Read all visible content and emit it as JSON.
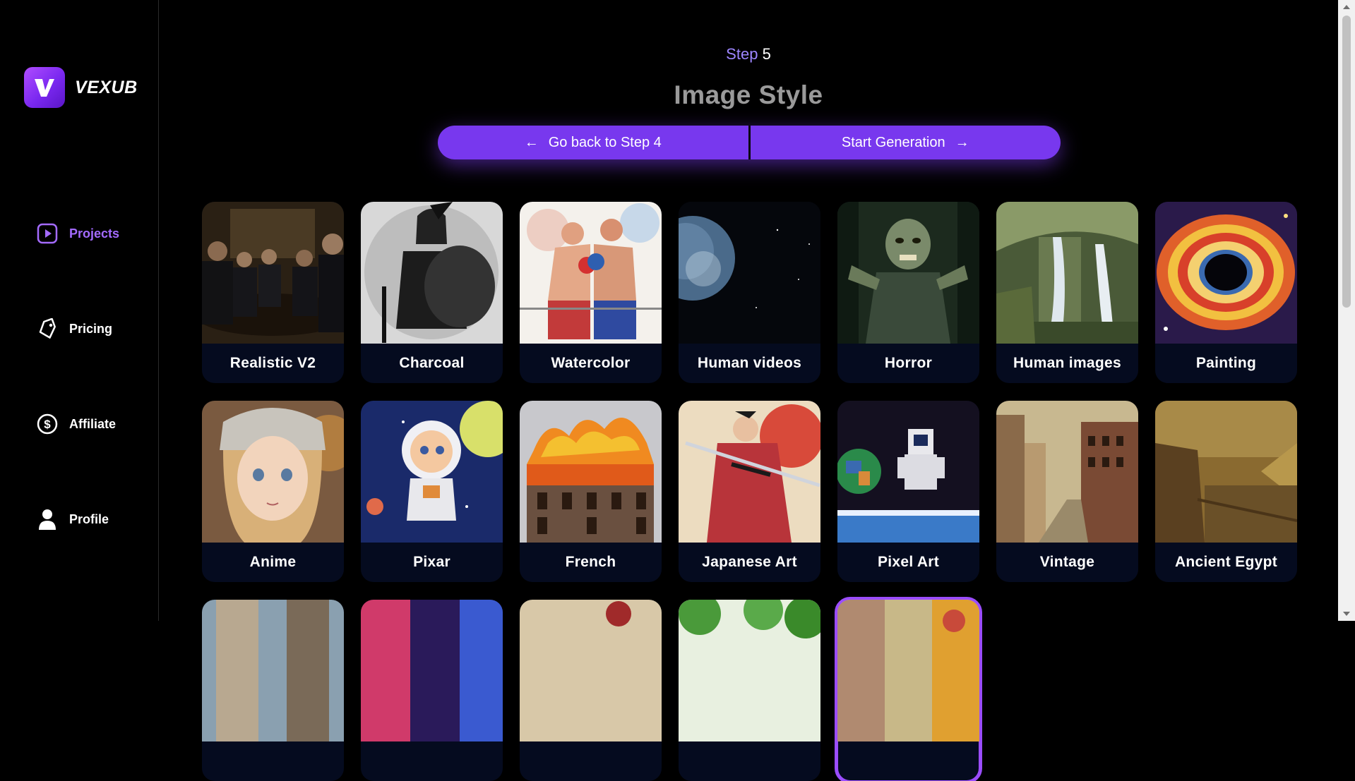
{
  "brand": {
    "name": "VEXUB"
  },
  "sidebar": {
    "items": [
      {
        "label": "Projects",
        "icon": "play-square-icon",
        "active": true
      },
      {
        "label": "Pricing",
        "icon": "tag-icon",
        "active": false
      },
      {
        "label": "Affiliate",
        "icon": "dollar-circle-icon",
        "active": false
      },
      {
        "label": "Profile",
        "icon": "user-icon",
        "active": false
      }
    ]
  },
  "header": {
    "step_word": "Step",
    "step_number": "5",
    "title": "Image Style"
  },
  "actions": {
    "back_label": "Go back to Step 4",
    "start_label": "Start Generation"
  },
  "styles": [
    {
      "label": "Realistic V2"
    },
    {
      "label": "Charcoal"
    },
    {
      "label": "Watercolor"
    },
    {
      "label": "Human videos"
    },
    {
      "label": "Horror"
    },
    {
      "label": "Human images"
    },
    {
      "label": "Painting"
    },
    {
      "label": "Anime"
    },
    {
      "label": "Pixar"
    },
    {
      "label": "French"
    },
    {
      "label": "Japanese Art"
    },
    {
      "label": "Pixel Art"
    },
    {
      "label": "Vintage"
    },
    {
      "label": "Ancient Egypt"
    }
  ],
  "colors": {
    "accent": "#7838ee",
    "accent_light": "#a46bff",
    "card_label_bg": "#050b1f",
    "selected_border": "#9b4dff"
  }
}
